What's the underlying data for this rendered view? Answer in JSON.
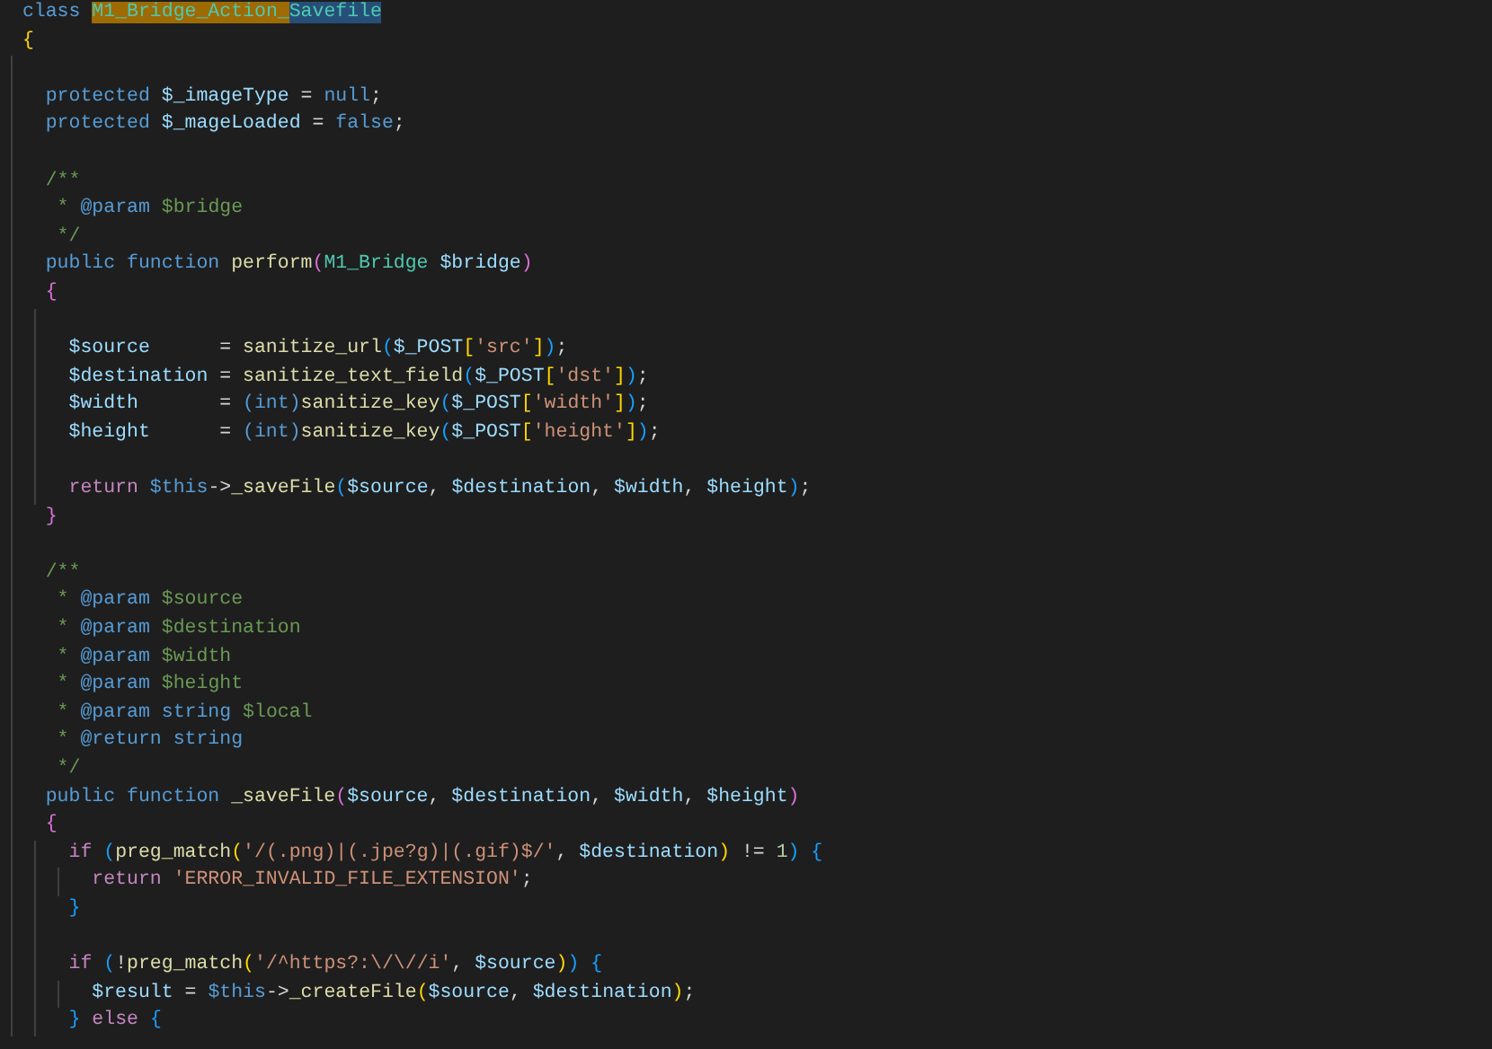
{
  "editor": {
    "lines": [
      {
        "gap_before": false,
        "tokens": [
          {
            "kind": "keyword",
            "text": "class "
          },
          {
            "kind": "type",
            "text": "M1_Bridge_Action_",
            "search_match": true,
            "selected": false
          },
          {
            "kind": "type",
            "text": "Savefile",
            "search_match": false,
            "selected": true
          }
        ]
      },
      {
        "gap_before": false,
        "tokens": [
          {
            "kind": "paren1",
            "text": "{"
          }
        ]
      },
      {
        "gap_before": true,
        "tokens": [
          {
            "kind": "keyword",
            "text": "  protected "
          },
          {
            "kind": "variable",
            "text": "$_imageType"
          },
          {
            "kind": "plain",
            "text": " = "
          },
          {
            "kind": "keyword",
            "text": "null"
          },
          {
            "kind": "plain",
            "text": ";"
          }
        ]
      },
      {
        "gap_before": false,
        "tokens": [
          {
            "kind": "keyword",
            "text": "  protected "
          },
          {
            "kind": "variable",
            "text": "$_mageLoaded"
          },
          {
            "kind": "plain",
            "text": " = "
          },
          {
            "kind": "keyword",
            "text": "false"
          },
          {
            "kind": "plain",
            "text": ";"
          }
        ]
      },
      {
        "gap_before": true,
        "tokens": [
          {
            "kind": "comment",
            "text": "  /**"
          }
        ]
      },
      {
        "gap_before": false,
        "tokens": [
          {
            "kind": "comment",
            "text": "   * "
          },
          {
            "kind": "tag",
            "text": "@param "
          },
          {
            "kind": "comment",
            "text": "$bridge"
          }
        ]
      },
      {
        "gap_before": false,
        "tokens": [
          {
            "kind": "comment",
            "text": "   */"
          }
        ]
      },
      {
        "gap_before": false,
        "tokens": [
          {
            "kind": "keyword",
            "text": "  public function "
          },
          {
            "kind": "function",
            "text": "perform"
          },
          {
            "kind": "paren2",
            "text": "("
          },
          {
            "kind": "type",
            "text": "M1_Bridge "
          },
          {
            "kind": "variable",
            "text": "$bridge"
          },
          {
            "kind": "paren2",
            "text": ")"
          }
        ]
      },
      {
        "gap_before": false,
        "tokens": [
          {
            "kind": "paren2",
            "text": "  {"
          }
        ]
      },
      {
        "gap_before": true,
        "tokens": [
          {
            "kind": "variable",
            "text": "    $source"
          },
          {
            "kind": "plain",
            "text": "      = "
          },
          {
            "kind": "function",
            "text": "sanitize_url"
          },
          {
            "kind": "paren3",
            "text": "("
          },
          {
            "kind": "variable",
            "text": "$_POST"
          },
          {
            "kind": "paren1",
            "text": "["
          },
          {
            "kind": "string",
            "text": "'src'"
          },
          {
            "kind": "paren1",
            "text": "]"
          },
          {
            "kind": "paren3",
            "text": ")"
          },
          {
            "kind": "plain",
            "text": ";"
          }
        ]
      },
      {
        "gap_before": false,
        "tokens": [
          {
            "kind": "variable",
            "text": "    $destination"
          },
          {
            "kind": "plain",
            "text": " = "
          },
          {
            "kind": "function",
            "text": "sanitize_text_field"
          },
          {
            "kind": "paren3",
            "text": "("
          },
          {
            "kind": "variable",
            "text": "$_POST"
          },
          {
            "kind": "paren1",
            "text": "["
          },
          {
            "kind": "string",
            "text": "'dst'"
          },
          {
            "kind": "paren1",
            "text": "]"
          },
          {
            "kind": "paren3",
            "text": ")"
          },
          {
            "kind": "plain",
            "text": ";"
          }
        ]
      },
      {
        "gap_before": false,
        "tokens": [
          {
            "kind": "variable",
            "text": "    $width"
          },
          {
            "kind": "plain",
            "text": "       = "
          },
          {
            "kind": "keyword",
            "text": "(int)"
          },
          {
            "kind": "function",
            "text": "sanitize_key"
          },
          {
            "kind": "paren3",
            "text": "("
          },
          {
            "kind": "variable",
            "text": "$_POST"
          },
          {
            "kind": "paren1",
            "text": "["
          },
          {
            "kind": "string",
            "text": "'width'"
          },
          {
            "kind": "paren1",
            "text": "]"
          },
          {
            "kind": "paren3",
            "text": ")"
          },
          {
            "kind": "plain",
            "text": ";"
          }
        ]
      },
      {
        "gap_before": false,
        "tokens": [
          {
            "kind": "variable",
            "text": "    $height"
          },
          {
            "kind": "plain",
            "text": "      = "
          },
          {
            "kind": "keyword",
            "text": "(int)"
          },
          {
            "kind": "function",
            "text": "sanitize_key"
          },
          {
            "kind": "paren3",
            "text": "("
          },
          {
            "kind": "variable",
            "text": "$_POST"
          },
          {
            "kind": "paren1",
            "text": "["
          },
          {
            "kind": "string",
            "text": "'height'"
          },
          {
            "kind": "paren1",
            "text": "]"
          },
          {
            "kind": "paren3",
            "text": ")"
          },
          {
            "kind": "plain",
            "text": ";"
          }
        ]
      },
      {
        "gap_before": true,
        "tokens": [
          {
            "kind": "control",
            "text": "    return "
          },
          {
            "kind": "keyword",
            "text": "$this"
          },
          {
            "kind": "plain",
            "text": "->"
          },
          {
            "kind": "function",
            "text": "_saveFile"
          },
          {
            "kind": "paren3",
            "text": "("
          },
          {
            "kind": "variable",
            "text": "$source"
          },
          {
            "kind": "plain",
            "text": ", "
          },
          {
            "kind": "variable",
            "text": "$destination"
          },
          {
            "kind": "plain",
            "text": ", "
          },
          {
            "kind": "variable",
            "text": "$width"
          },
          {
            "kind": "plain",
            "text": ", "
          },
          {
            "kind": "variable",
            "text": "$height"
          },
          {
            "kind": "paren3",
            "text": ")"
          },
          {
            "kind": "plain",
            "text": ";"
          }
        ]
      },
      {
        "gap_before": false,
        "tokens": [
          {
            "kind": "paren2",
            "text": "  }"
          }
        ]
      },
      {
        "gap_before": true,
        "tokens": [
          {
            "kind": "comment",
            "text": "  /**"
          }
        ]
      },
      {
        "gap_before": false,
        "tokens": [
          {
            "kind": "comment",
            "text": "   * "
          },
          {
            "kind": "tag",
            "text": "@param "
          },
          {
            "kind": "comment",
            "text": "$source"
          }
        ]
      },
      {
        "gap_before": false,
        "tokens": [
          {
            "kind": "comment",
            "text": "   * "
          },
          {
            "kind": "tag",
            "text": "@param "
          },
          {
            "kind": "comment",
            "text": "$destination"
          }
        ]
      },
      {
        "gap_before": false,
        "tokens": [
          {
            "kind": "comment",
            "text": "   * "
          },
          {
            "kind": "tag",
            "text": "@param "
          },
          {
            "kind": "comment",
            "text": "$width"
          }
        ]
      },
      {
        "gap_before": false,
        "tokens": [
          {
            "kind": "comment",
            "text": "   * "
          },
          {
            "kind": "tag",
            "text": "@param "
          },
          {
            "kind": "comment",
            "text": "$height"
          }
        ]
      },
      {
        "gap_before": false,
        "tokens": [
          {
            "kind": "comment",
            "text": "   * "
          },
          {
            "kind": "tag",
            "text": "@param string "
          },
          {
            "kind": "comment",
            "text": "$local"
          }
        ]
      },
      {
        "gap_before": false,
        "tokens": [
          {
            "kind": "comment",
            "text": "   * "
          },
          {
            "kind": "tag",
            "text": "@return string"
          }
        ]
      },
      {
        "gap_before": false,
        "tokens": [
          {
            "kind": "comment",
            "text": "   */"
          }
        ]
      },
      {
        "gap_before": false,
        "tokens": [
          {
            "kind": "keyword",
            "text": "  public function "
          },
          {
            "kind": "function",
            "text": "_saveFile"
          },
          {
            "kind": "paren2",
            "text": "("
          },
          {
            "kind": "variable",
            "text": "$source"
          },
          {
            "kind": "plain",
            "text": ", "
          },
          {
            "kind": "variable",
            "text": "$destination"
          },
          {
            "kind": "plain",
            "text": ", "
          },
          {
            "kind": "variable",
            "text": "$width"
          },
          {
            "kind": "plain",
            "text": ", "
          },
          {
            "kind": "variable",
            "text": "$height"
          },
          {
            "kind": "paren2",
            "text": ")"
          }
        ]
      },
      {
        "gap_before": false,
        "tokens": [
          {
            "kind": "paren2",
            "text": "  {"
          }
        ]
      },
      {
        "gap_before": false,
        "tokens": [
          {
            "kind": "control",
            "text": "    if "
          },
          {
            "kind": "paren3",
            "text": "("
          },
          {
            "kind": "function",
            "text": "preg_match"
          },
          {
            "kind": "paren1",
            "text": "("
          },
          {
            "kind": "string",
            "text": "'/(.png)|(.jpe?g)|(.gif)$/'"
          },
          {
            "kind": "plain",
            "text": ", "
          },
          {
            "kind": "variable",
            "text": "$destination"
          },
          {
            "kind": "paren1",
            "text": ")"
          },
          {
            "kind": "plain",
            "text": " != "
          },
          {
            "kind": "number",
            "text": "1"
          },
          {
            "kind": "paren3",
            "text": ")"
          },
          {
            "kind": "paren3",
            "text": " {"
          }
        ]
      },
      {
        "gap_before": false,
        "tokens": [
          {
            "kind": "control",
            "text": "      return "
          },
          {
            "kind": "string",
            "text": "'ERROR_INVALID_FILE_EXTENSION'"
          },
          {
            "kind": "plain",
            "text": ";"
          }
        ]
      },
      {
        "gap_before": false,
        "tokens": [
          {
            "kind": "paren3",
            "text": "    }"
          }
        ]
      },
      {
        "gap_before": true,
        "tokens": [
          {
            "kind": "control",
            "text": "    if "
          },
          {
            "kind": "paren3",
            "text": "("
          },
          {
            "kind": "plain",
            "text": "!"
          },
          {
            "kind": "function",
            "text": "preg_match"
          },
          {
            "kind": "paren1",
            "text": "("
          },
          {
            "kind": "string",
            "text": "'/^https?:\\/\\//i'"
          },
          {
            "kind": "plain",
            "text": ", "
          },
          {
            "kind": "variable",
            "text": "$source"
          },
          {
            "kind": "paren1",
            "text": ")"
          },
          {
            "kind": "paren3",
            "text": ")"
          },
          {
            "kind": "paren3",
            "text": " {"
          }
        ]
      },
      {
        "gap_before": false,
        "tokens": [
          {
            "kind": "variable",
            "text": "      $result"
          },
          {
            "kind": "plain",
            "text": " = "
          },
          {
            "kind": "keyword",
            "text": "$this"
          },
          {
            "kind": "plain",
            "text": "->"
          },
          {
            "kind": "function",
            "text": "_createFile"
          },
          {
            "kind": "paren1",
            "text": "("
          },
          {
            "kind": "variable",
            "text": "$source"
          },
          {
            "kind": "plain",
            "text": ", "
          },
          {
            "kind": "variable",
            "text": "$destination"
          },
          {
            "kind": "paren1",
            "text": ")"
          },
          {
            "kind": "plain",
            "text": ";"
          }
        ]
      },
      {
        "gap_before": false,
        "tokens": [
          {
            "kind": "paren3",
            "text": "    }"
          },
          {
            "kind": "control",
            "text": " else "
          },
          {
            "kind": "paren3",
            "text": "{"
          }
        ]
      }
    ]
  }
}
